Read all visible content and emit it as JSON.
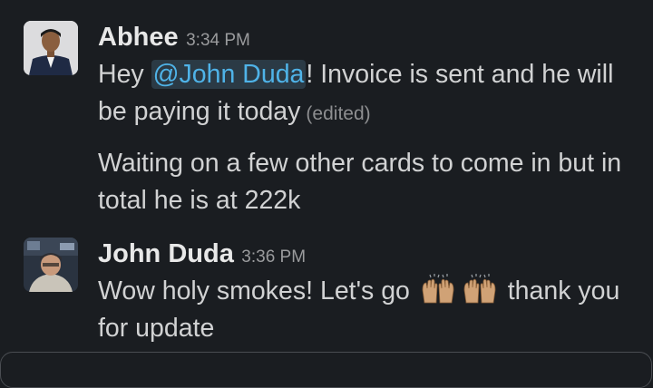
{
  "messages": [
    {
      "author": "Abhee",
      "time": "3:34 PM",
      "avatar_icon": "person-in-suit-avatar",
      "paragraphs": [
        {
          "before": "Hey ",
          "mention": "@John Duda",
          "after": "! Invoice is sent and he will be paying it today",
          "edited": "(edited)"
        },
        {
          "text": "Waiting on a few other cards to come in but in total he is at 222k"
        }
      ]
    },
    {
      "author": "John Duda",
      "time": "3:36 PM",
      "avatar_icon": "selfie-avatar",
      "text_before": "Wow holy smokes! Let's go",
      "emoji": [
        "raising-hands-emoji",
        "raising-hands-emoji"
      ],
      "text_after": "thank you for update"
    }
  ],
  "colors": {
    "background": "#1a1d21",
    "mention_text": "#4fb3e8",
    "mention_bg": "#2b3a45"
  }
}
